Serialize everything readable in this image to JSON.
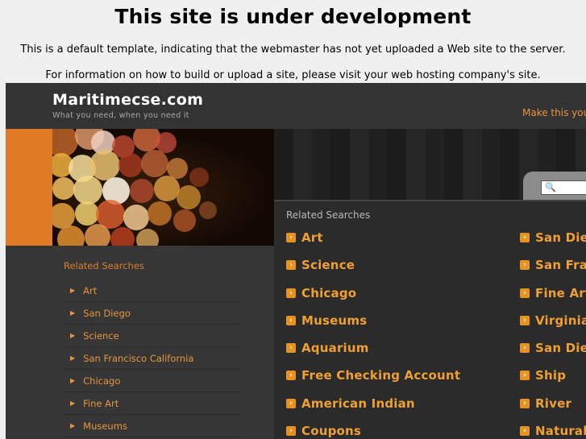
{
  "notice": {
    "heading": "This site is under development",
    "line1": "This is a default template, indicating that the webmaster has not yet uploaded a Web site to the server.",
    "line2": "For information on how to build or upload a site, please visit your web hosting company's site."
  },
  "header": {
    "site_title": "Maritimecse.com",
    "tagline": "What you need, when you need it",
    "bookmark_link": "Make this your"
  },
  "search": {
    "value": "",
    "icon": "magnifier-icon"
  },
  "sidebar": {
    "title": "Related Searches",
    "items": [
      "Art",
      "San Diego",
      "Science",
      "San Francisco California",
      "Chicago",
      "Fine Art",
      "Museums"
    ]
  },
  "main": {
    "title": "Related Searches",
    "col1": [
      "Art",
      "Science",
      "Chicago",
      "Museums",
      "Aquarium",
      "Free Checking Account",
      "American Indian",
      "Coupons"
    ],
    "col2": [
      "San Dieg",
      "San Fran",
      "Fine Art",
      "Virginia",
      "San Dieg",
      "Ship",
      "River",
      "Natural"
    ]
  },
  "colors": {
    "accent": "#e8963a",
    "orange_strip": "#e07a24",
    "background": "#2f2f2f"
  }
}
